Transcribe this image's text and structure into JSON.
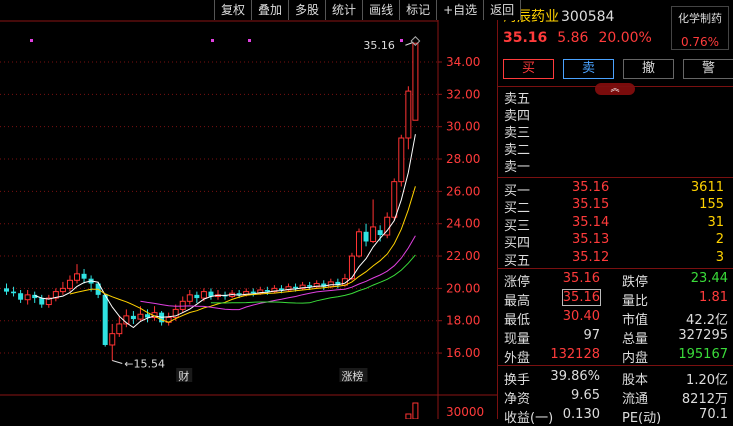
{
  "toolbar": [
    "复权",
    "叠加",
    "多股",
    "统计",
    "画线",
    "标记",
    "+自选",
    "返回"
  ],
  "chart_data": {
    "type": "candlestick",
    "y_ticks": [
      "34.00",
      "32.00",
      "30.00",
      "28.00",
      "26.00",
      "24.00",
      "22.00",
      "20.00",
      "18.00",
      "16.00"
    ],
    "ylim": [
      15.0,
      35.7
    ],
    "high_label": "35.16",
    "low_label": "15.54",
    "volume_tick": "30000",
    "markers": [
      {
        "label": "财",
        "index": 25
      },
      {
        "label": "涨榜",
        "index": 49
      }
    ],
    "candles": [
      {
        "o": 20.0,
        "c": 19.8,
        "h": 20.3,
        "l": 19.6
      },
      {
        "o": 19.8,
        "c": 19.7,
        "h": 20.1,
        "l": 19.5
      },
      {
        "o": 19.7,
        "c": 19.3,
        "h": 19.9,
        "l": 19.1
      },
      {
        "o": 19.3,
        "c": 19.6,
        "h": 19.9,
        "l": 19.0
      },
      {
        "o": 19.6,
        "c": 19.4,
        "h": 19.8,
        "l": 19.1
      },
      {
        "o": 19.4,
        "c": 19.0,
        "h": 19.6,
        "l": 18.8
      },
      {
        "o": 19.0,
        "c": 19.4,
        "h": 19.6,
        "l": 18.8
      },
      {
        "o": 19.4,
        "c": 19.8,
        "h": 20.0,
        "l": 19.2
      },
      {
        "o": 19.8,
        "c": 20.0,
        "h": 20.4,
        "l": 19.6
      },
      {
        "o": 20.0,
        "c": 20.5,
        "h": 20.8,
        "l": 19.8
      },
      {
        "o": 20.5,
        "c": 20.9,
        "h": 21.5,
        "l": 20.3
      },
      {
        "o": 20.9,
        "c": 20.6,
        "h": 21.2,
        "l": 20.3
      },
      {
        "o": 20.6,
        "c": 20.3,
        "h": 20.8,
        "l": 19.8
      },
      {
        "o": 20.3,
        "c": 19.6,
        "h": 20.4,
        "l": 19.4
      },
      {
        "o": 19.6,
        "c": 16.5,
        "h": 19.6,
        "l": 16.4
      },
      {
        "o": 16.5,
        "c": 17.2,
        "h": 17.8,
        "l": 15.54
      },
      {
        "o": 17.2,
        "c": 17.8,
        "h": 18.3,
        "l": 17.0
      },
      {
        "o": 17.8,
        "c": 18.3,
        "h": 18.7,
        "l": 17.6
      },
      {
        "o": 18.3,
        "c": 18.1,
        "h": 18.6,
        "l": 17.8
      },
      {
        "o": 18.1,
        "c": 18.4,
        "h": 18.9,
        "l": 18.0
      },
      {
        "o": 18.4,
        "c": 18.2,
        "h": 18.7,
        "l": 17.9
      },
      {
        "o": 18.2,
        "c": 18.5,
        "h": 18.9,
        "l": 18.0
      },
      {
        "o": 18.5,
        "c": 17.9,
        "h": 18.6,
        "l": 17.7
      },
      {
        "o": 17.9,
        "c": 18.2,
        "h": 18.5,
        "l": 17.7
      },
      {
        "o": 18.2,
        "c": 18.7,
        "h": 19.0,
        "l": 18.0
      },
      {
        "o": 18.7,
        "c": 19.2,
        "h": 19.5,
        "l": 18.5
      },
      {
        "o": 19.2,
        "c": 19.6,
        "h": 19.9,
        "l": 19.0
      },
      {
        "o": 19.6,
        "c": 19.4,
        "h": 19.8,
        "l": 19.1
      },
      {
        "o": 19.4,
        "c": 19.8,
        "h": 20.0,
        "l": 19.2
      },
      {
        "o": 19.8,
        "c": 19.5,
        "h": 20.0,
        "l": 19.3
      },
      {
        "o": 19.5,
        "c": 19.6,
        "h": 19.9,
        "l": 19.3
      },
      {
        "o": 19.6,
        "c": 19.5,
        "h": 19.8,
        "l": 19.3
      },
      {
        "o": 19.5,
        "c": 19.7,
        "h": 19.9,
        "l": 19.4
      },
      {
        "o": 19.7,
        "c": 19.6,
        "h": 19.9,
        "l": 19.4
      },
      {
        "o": 19.6,
        "c": 19.8,
        "h": 20.0,
        "l": 19.5
      },
      {
        "o": 19.8,
        "c": 19.7,
        "h": 20.0,
        "l": 19.5
      },
      {
        "o": 19.7,
        "c": 19.9,
        "h": 20.1,
        "l": 19.6
      },
      {
        "o": 19.9,
        "c": 19.8,
        "h": 20.1,
        "l": 19.6
      },
      {
        "o": 19.8,
        "c": 20.0,
        "h": 20.2,
        "l": 19.7
      },
      {
        "o": 20.0,
        "c": 19.9,
        "h": 20.2,
        "l": 19.7
      },
      {
        "o": 19.9,
        "c": 20.1,
        "h": 20.3,
        "l": 19.8
      },
      {
        "o": 20.1,
        "c": 20.0,
        "h": 20.3,
        "l": 19.8
      },
      {
        "o": 20.0,
        "c": 20.2,
        "h": 20.4,
        "l": 19.9
      },
      {
        "o": 20.2,
        "c": 20.1,
        "h": 20.4,
        "l": 19.9
      },
      {
        "o": 20.1,
        "c": 20.3,
        "h": 20.5,
        "l": 20.0
      },
      {
        "o": 20.3,
        "c": 20.1,
        "h": 20.5,
        "l": 19.9
      },
      {
        "o": 20.1,
        "c": 20.4,
        "h": 20.6,
        "l": 20.0
      },
      {
        "o": 20.4,
        "c": 20.2,
        "h": 20.6,
        "l": 20.0
      },
      {
        "o": 20.2,
        "c": 20.6,
        "h": 20.9,
        "l": 20.1
      },
      {
        "o": 20.6,
        "c": 22.0,
        "h": 22.2,
        "l": 20.5
      },
      {
        "o": 22.0,
        "c": 23.5,
        "h": 23.7,
        "l": 21.9
      },
      {
        "o": 23.5,
        "c": 22.9,
        "h": 24.0,
        "l": 22.6
      },
      {
        "o": 22.9,
        "c": 23.8,
        "h": 25.5,
        "l": 22.8
      },
      {
        "o": 23.6,
        "c": 23.3,
        "h": 23.9,
        "l": 22.9
      },
      {
        "o": 23.3,
        "c": 24.4,
        "h": 24.7,
        "l": 23.1
      },
      {
        "o": 24.4,
        "c": 26.6,
        "h": 26.8,
        "l": 24.2
      },
      {
        "o": 26.6,
        "c": 29.3,
        "h": 29.5,
        "l": 26.3
      },
      {
        "o": 29.3,
        "c": 32.2,
        "h": 32.5,
        "l": 28.6
      },
      {
        "o": 30.4,
        "c": 35.16,
        "h": 35.16,
        "l": 30.4
      }
    ]
  },
  "stock": {
    "name": "海辰药业",
    "code": "300584",
    "price": "35.16",
    "change": "5.86",
    "pct": "20.00%"
  },
  "sector": {
    "name": "化学制药",
    "pct": "0.76%"
  },
  "actions": {
    "buy": "买",
    "sell": "卖",
    "cancel": "撤",
    "alert": "警"
  },
  "collapse_label": "︽",
  "sell_book": [
    "卖五",
    "卖四",
    "卖三",
    "卖二",
    "卖一"
  ],
  "buy_book": [
    {
      "label": "买一",
      "price": "35.16",
      "vol": "3611"
    },
    {
      "label": "买二",
      "price": "35.15",
      "vol": "155"
    },
    {
      "label": "买三",
      "price": "35.14",
      "vol": "31"
    },
    {
      "label": "买四",
      "price": "35.13",
      "vol": "2"
    },
    {
      "label": "买五",
      "price": "35.12",
      "vol": "3"
    }
  ],
  "stats": [
    {
      "l1": "涨停",
      "v1": "35.16",
      "c1": "r",
      "l2": "跌停",
      "v2": "23.44",
      "c2": "g"
    },
    {
      "l1": "最高",
      "v1": "35.16",
      "c1": "r",
      "l2": "量比",
      "v2": "1.81",
      "c2": "r",
      "box1": true
    },
    {
      "l1": "最低",
      "v1": "30.40",
      "c1": "r",
      "l2": "市值",
      "v2": "42.2亿",
      "c2": "w"
    },
    {
      "l1": "现量",
      "v1": "97",
      "c1": "w",
      "l2": "总量",
      "v2": "327295",
      "c2": "w"
    },
    {
      "l1": "外盘",
      "v1": "132128",
      "c1": "r",
      "l2": "内盘",
      "v2": "195167",
      "c2": "g"
    }
  ],
  "stats2": [
    {
      "l1": "换手",
      "v1": "39.86%",
      "c1": "w",
      "l2": "股本",
      "v2": "1.20亿",
      "c2": "w"
    },
    {
      "l1": "净资",
      "v1": "9.65",
      "c1": "w",
      "l2": "流通",
      "v2": "8212万",
      "c2": "w"
    },
    {
      "l1": "收益(一)",
      "v1": "0.130",
      "c1": "w",
      "l2": "PE(动)",
      "v2": "70.1",
      "c2": "w"
    }
  ]
}
